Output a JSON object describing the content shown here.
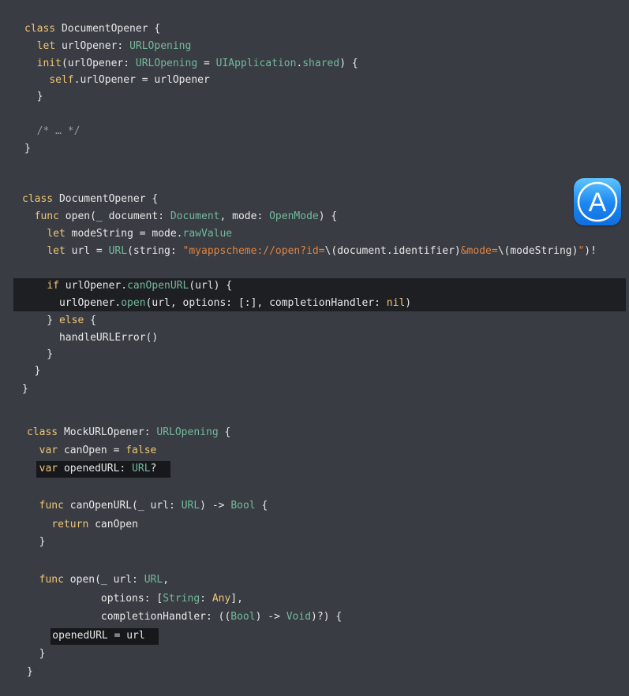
{
  "colors": {
    "background": "#393c43",
    "keyword": "#f0c674",
    "type": "#74b99b",
    "string": "#e1833f",
    "comment": "#9a9ca3",
    "text": "#e8e8e8",
    "highlight": "#1d1f23",
    "app_icon": "#1a86f0"
  },
  "app_icon": {
    "icon": "app-store-icon",
    "glyph": "A"
  },
  "blocks": [
    {
      "name": "block-document-opener-init",
      "lines": [
        [
          [
            "k",
            "class"
          ],
          [
            "p",
            " DocumentOpener {"
          ]
        ],
        [
          [
            "p",
            "  "
          ],
          [
            "k",
            "let"
          ],
          [
            "p",
            " urlOpener: "
          ],
          [
            "t",
            "URLOpening"
          ]
        ],
        [
          [
            "p",
            "  "
          ],
          [
            "k",
            "init"
          ],
          [
            "p",
            "(urlOpener: "
          ],
          [
            "t",
            "URLOpening"
          ],
          [
            "p",
            " = "
          ],
          [
            "t",
            "UIApplication"
          ],
          [
            "p",
            "."
          ],
          [
            "t",
            "shared"
          ],
          [
            "p",
            ") {"
          ]
        ],
        [
          [
            "p",
            "    "
          ],
          [
            "k",
            "self"
          ],
          [
            "p",
            ".urlOpener = urlOpener"
          ]
        ],
        [
          [
            "p",
            "  }"
          ]
        ],
        [
          [
            "p",
            ""
          ]
        ],
        [
          [
            "p",
            "  "
          ],
          [
            "c",
            "/* … */"
          ]
        ],
        [
          [
            "p",
            "}"
          ]
        ]
      ]
    },
    {
      "name": "block-document-opener-open",
      "lines": [
        [
          [
            "k",
            "class"
          ],
          [
            "p",
            " DocumentOpener {"
          ]
        ],
        [
          [
            "p",
            "  "
          ],
          [
            "k",
            "func"
          ],
          [
            "p",
            " open(_ document: "
          ],
          [
            "t",
            "Document"
          ],
          [
            "p",
            ", mode: "
          ],
          [
            "t",
            "OpenMode"
          ],
          [
            "p",
            ") {"
          ]
        ],
        [
          [
            "p",
            "    "
          ],
          [
            "k",
            "let"
          ],
          [
            "p",
            " modeString = mode."
          ],
          [
            "t",
            "rawValue"
          ]
        ],
        [
          [
            "p",
            "    "
          ],
          [
            "k",
            "let"
          ],
          [
            "p",
            " url = "
          ],
          [
            "t",
            "URL"
          ],
          [
            "p",
            "(string: "
          ],
          [
            "s",
            "\"myappscheme://open?id="
          ],
          [
            "p",
            "\\(document.identifier)"
          ],
          [
            "s",
            "&mode="
          ],
          [
            "p",
            "\\(modeString)"
          ],
          [
            "s",
            "\""
          ],
          [
            "p",
            ")!"
          ]
        ],
        [
          [
            "p",
            ""
          ]
        ],
        [
          [
            "p",
            "    "
          ],
          [
            "k",
            "if"
          ],
          [
            "p",
            " urlOpener."
          ],
          [
            "t",
            "canOpenURL"
          ],
          [
            "p",
            "(url) {"
          ]
        ],
        [
          [
            "p",
            "      urlOpener."
          ],
          [
            "t",
            "open"
          ],
          [
            "p",
            "(url, options: [:], completionHandler: "
          ],
          [
            "k",
            "nil"
          ],
          [
            "p",
            ")"
          ]
        ],
        [
          [
            "p",
            "    } "
          ],
          [
            "k",
            "else"
          ],
          [
            "p",
            " {"
          ]
        ],
        [
          [
            "p",
            "      handleURLError()"
          ]
        ],
        [
          [
            "p",
            "    }"
          ]
        ],
        [
          [
            "p",
            "  }"
          ]
        ],
        [
          [
            "p",
            "}"
          ]
        ]
      ]
    },
    {
      "name": "block-mock-url-opener",
      "lines": [
        [
          [
            "k",
            "class"
          ],
          [
            "p",
            " MockURLOpener: "
          ],
          [
            "t",
            "URLOpening"
          ],
          [
            "p",
            " {"
          ]
        ],
        [
          [
            "p",
            "  "
          ],
          [
            "k",
            "var"
          ],
          [
            "p",
            " canOpen = "
          ],
          [
            "k",
            "false"
          ]
        ],
        [
          [
            "p",
            "  "
          ],
          [
            "k",
            "var"
          ],
          [
            "p",
            " openedURL: "
          ],
          [
            "t",
            "URL"
          ],
          [
            "p",
            "?"
          ]
        ],
        [
          [
            "p",
            ""
          ]
        ],
        [
          [
            "p",
            "  "
          ],
          [
            "k",
            "func"
          ],
          [
            "p",
            " canOpenURL(_ url: "
          ],
          [
            "t",
            "URL"
          ],
          [
            "p",
            ") -> "
          ],
          [
            "t",
            "Bool"
          ],
          [
            "p",
            " {"
          ]
        ],
        [
          [
            "p",
            "    "
          ],
          [
            "k",
            "return"
          ],
          [
            "p",
            " canOpen"
          ]
        ],
        [
          [
            "p",
            "  }"
          ]
        ],
        [
          [
            "p",
            ""
          ]
        ],
        [
          [
            "p",
            "  "
          ],
          [
            "k",
            "func"
          ],
          [
            "p",
            " open(_ url: "
          ],
          [
            "t",
            "URL"
          ],
          [
            "p",
            ","
          ]
        ],
        [
          [
            "p",
            "            options: ["
          ],
          [
            "t",
            "String"
          ],
          [
            "p",
            ": "
          ],
          [
            "k",
            "Any"
          ],
          [
            "p",
            "],"
          ]
        ],
        [
          [
            "p",
            "            completionHandler: (("
          ],
          [
            "t",
            "Bool"
          ],
          [
            "p",
            ") -> "
          ],
          [
            "t",
            "Void"
          ],
          [
            "p",
            ")?) {"
          ]
        ],
        [
          [
            "p",
            "    openedURL = url"
          ]
        ],
        [
          [
            "p",
            "  }"
          ]
        ],
        [
          [
            "p",
            "}"
          ]
        ]
      ]
    }
  ]
}
